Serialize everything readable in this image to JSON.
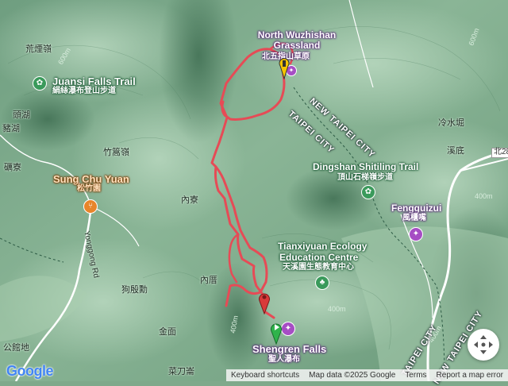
{
  "map": {
    "labels": {
      "north_wuzhishan_en": "North Wuzhishan Grassland",
      "north_wuzhishan_zh": "北五指山草原",
      "juansi_en": "Juansi Falls Trail",
      "juansi_zh": "絹絲瀑布登山步道",
      "sungchu_en": "Sung Chu Yuan",
      "sungchu_zh": "松竹園",
      "dingshan_en": "Dingshan Shitiling Trail",
      "dingshan_zh": "頂山石梯嶺步道",
      "fengguizui_en": "Fengguizui",
      "fengguizui_zh": "風櫃嘴",
      "tianxiyuan_en1": "Tianxiyuan Ecology",
      "tianxiyuan_en2": "Education Centre",
      "tianxiyuan_zh": "天溪園生態教育中心",
      "shengren_en": "Shengren Falls",
      "shengren_zh": "聖人瀑布",
      "new_taipei_city_ne": "NEW TAIPEI CITY",
      "taipei_city_ne": "TAIPEI CITY",
      "taipei_city_s": "TAIPEI CITY",
      "new_taipei_city_s": "NEW TAIPEI CITY",
      "place_huangxiling": "荒煙嶺",
      "place_toulake": "頭湖",
      "place_zhuhu": "豬湖",
      "place_zhugaoling": "竹篙嶺",
      "place_jiliao": "礪寮",
      "place_neiliao": "內寮",
      "place_neiwu": "內厝",
      "place_goudianken": "狗殷勳",
      "place_jinmian": "金面",
      "place_gongguandi": "公館地",
      "place_caidaolan": "菜刀崙",
      "place_lengshuikeng": "冷水堀",
      "place_xidi": "溪底",
      "road_yongong": "Yonggong Rd",
      "road_north28": "北28"
    },
    "elevations": [
      "400m",
      "400m",
      "400m",
      "600m",
      "600m",
      "400m"
    ],
    "colors": {
      "track": "#e64b56",
      "poi_green": "#3a9a5b",
      "poi_orange": "#e8852a",
      "poi_purple": "#a64ec4",
      "start_pin": "#2fb34b",
      "end_pin": "#d93a3a",
      "waypoint_pin": "#f5c400"
    },
    "icons": [
      "park-icon",
      "restaurant-icon",
      "museum-icon",
      "tree-icon",
      "start-pin-icon",
      "end-pin-icon",
      "waypoint-pin-icon",
      "camera-control-icon"
    ]
  },
  "footer": {
    "logo": "Google",
    "shortcuts": "Keyboard shortcuts",
    "map_data": "Map data ©2025 Google",
    "terms": "Terms",
    "report": "Report a map error"
  }
}
